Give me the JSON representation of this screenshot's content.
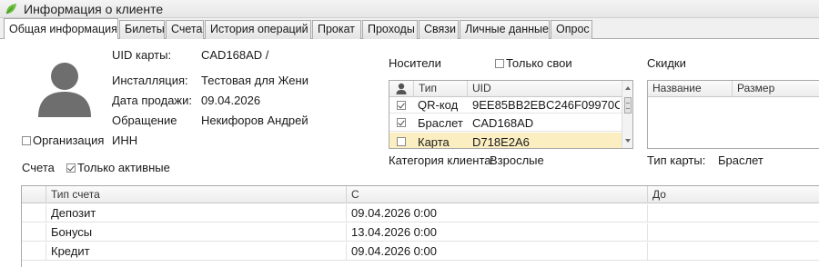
{
  "window": {
    "title": "Информация о клиенте"
  },
  "tabs": [
    {
      "label": "Общая информация",
      "active": true
    },
    {
      "label": "Билеты"
    },
    {
      "label": "Счета"
    },
    {
      "label": "История операций"
    },
    {
      "label": "Прокат"
    },
    {
      "label": "Проходы"
    },
    {
      "label": "Связи"
    },
    {
      "label": "Личные данные"
    },
    {
      "label": "Опрос"
    }
  ],
  "client": {
    "card_uid_label": "UID карты:",
    "card_uid_value": "CAD168AD /",
    "installation_label": "Инсталляция:",
    "installation_value": "Тестовая для Жени",
    "sale_date_label": "Дата продажи:",
    "sale_date_value": "09.04.2026",
    "salutation_label": "Обращение",
    "salutation_value": "Некифоров Андрей",
    "organization_label": "Организация",
    "organization_checked": false,
    "inn_label": "ИНН"
  },
  "carriers": {
    "title": "Носители",
    "only_own_label": "Только свои",
    "only_own_checked": false,
    "columns": [
      "Тип",
      "UID"
    ],
    "rows": [
      {
        "checked": true,
        "type": "QR-код",
        "uid": "9EE85BB2EBC246F09970C..."
      },
      {
        "checked": true,
        "type": "Браслет",
        "uid": "CAD168AD"
      },
      {
        "checked": false,
        "type": "Карта",
        "uid": "D718E2A6",
        "highlighted": true
      }
    ],
    "category_label": "Категория клиента:",
    "category_value": "Взрослые"
  },
  "discounts": {
    "title": "Скидки",
    "columns": [
      "Название",
      "Размер"
    ],
    "card_type_label": "Тип карты:",
    "card_type_value": "Браслет"
  },
  "accounts": {
    "title": "Счета",
    "only_active_label": "Только активные",
    "only_active_checked": true,
    "columns": [
      "Тип счета",
      "С",
      "До"
    ],
    "rows": [
      {
        "type": "Депозит",
        "from": "09.04.2026 0:00",
        "to": ""
      },
      {
        "type": "Бонусы",
        "from": "13.04.2026 0:00",
        "to": ""
      },
      {
        "type": "Кредит",
        "from": "09.04.2026 0:00",
        "to": ""
      }
    ]
  },
  "colors": {
    "accent_leaf": "#6cbf3f",
    "avatar": "#6e6e6e",
    "highlight_row": "#fbefc2"
  },
  "icons": {
    "window": "leaf-icon",
    "avatar": "user-silhouette-icon",
    "carrier_header": "person-icon"
  }
}
